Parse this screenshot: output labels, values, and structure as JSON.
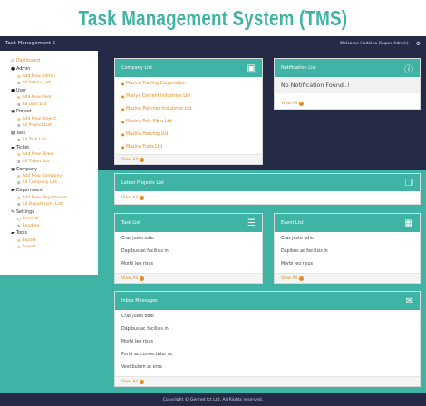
{
  "page_title": "Task Management System (TMS)",
  "navbar": {
    "brand": "Task Management S",
    "welcome": "Welcome Hodclea (Super Admin)",
    "user_icon": "gear-icon"
  },
  "sidebar": [
    {
      "label": "Dashboard",
      "icon": "dashboard-icon",
      "glyph": "⌂",
      "items": []
    },
    {
      "label": "Admin",
      "icon": "user-icon",
      "glyph": "●",
      "items": [
        {
          "label": "Add New Admin",
          "glyph": "⊕"
        },
        {
          "label": "All Admin List",
          "glyph": "≡"
        }
      ]
    },
    {
      "label": "User",
      "icon": "users-icon",
      "glyph": "●",
      "items": [
        {
          "label": "Add New User",
          "glyph": "⊕"
        },
        {
          "label": "All User List",
          "glyph": "≡"
        }
      ]
    },
    {
      "label": "Project",
      "icon": "project-icon",
      "glyph": "▣",
      "items": [
        {
          "label": "Add New Project",
          "glyph": "⊕"
        },
        {
          "label": "All Project List",
          "glyph": "≡"
        }
      ]
    },
    {
      "label": "Task",
      "icon": "task-icon",
      "glyph": "▤",
      "items": [
        {
          "label": "All Task List",
          "glyph": "≡"
        }
      ]
    },
    {
      "label": "Ticket",
      "icon": "ticket-icon",
      "glyph": "▰",
      "items": [
        {
          "label": "Add New Ticket",
          "glyph": "⊕"
        },
        {
          "label": "All Ticket List",
          "glyph": "≡"
        }
      ]
    },
    {
      "label": "Company",
      "icon": "company-icon",
      "glyph": "▣",
      "items": [
        {
          "label": "Add New Company",
          "glyph": "⊕"
        },
        {
          "label": "All Company List",
          "glyph": "≡"
        }
      ]
    },
    {
      "label": "Department",
      "icon": "department-icon",
      "glyph": "▰",
      "items": [
        {
          "label": "Add New Department",
          "glyph": "⊕"
        },
        {
          "label": "All Department List",
          "glyph": "≡"
        }
      ]
    },
    {
      "label": "Settings",
      "icon": "wrench-icon",
      "glyph": "✎",
      "items": [
        {
          "label": "General",
          "glyph": "○"
        },
        {
          "label": "Reading",
          "glyph": "✎"
        }
      ]
    },
    {
      "label": "Tools",
      "icon": "tools-icon",
      "glyph": "▰",
      "items": [
        {
          "label": "Export",
          "glyph": "⊕"
        },
        {
          "label": "Import",
          "glyph": "⊕"
        }
      ]
    }
  ],
  "company_list": {
    "title": "Company List",
    "icon": "briefcase-icon",
    "items": [
      "Mazina Trading Corporation",
      "Mariya Cement Industries Ltd",
      "Mazina Polymer Industries Ltd",
      "Mazina Poly Fiber Ltd",
      "Mazina Hatchig Ltd",
      "Mazina Fuels Ltd"
    ],
    "footer": "View All"
  },
  "notification_list": {
    "title": "Notification List",
    "icon": "info-icon",
    "message": "No Notification Found..!",
    "footer": "View All"
  },
  "projects_list": {
    "title": "Latest Projects List",
    "icon": "copy-icon",
    "footer": "View All"
  },
  "task_list": {
    "title": "Task List",
    "icon": "list-icon",
    "items": [
      "Cras justo odio",
      "Dapibus ac facilisis in",
      "Morbi leo risus"
    ],
    "footer": "View All"
  },
  "event_list": {
    "title": "Event List",
    "icon": "calendar-icon",
    "items": [
      "Cras justo odio",
      "Dapibus ac facilisis in",
      "Morbi leo risus"
    ],
    "footer": "View All"
  },
  "inbox": {
    "title": "Inbox Messages",
    "icon": "envelope-icon",
    "items": [
      "Cras justo odio",
      "Dapibus ac facilisis in",
      "Morbi leo risus",
      "Porta ac consectetur ac",
      "Vestibulum at eros"
    ],
    "footer": "View All"
  },
  "footer": "Copyright © Gennet Ict Ltd. All Rights reserved.",
  "colors": {
    "teal": "#3fb3a4",
    "navy": "#252a47",
    "orange": "#e08a1e"
  }
}
